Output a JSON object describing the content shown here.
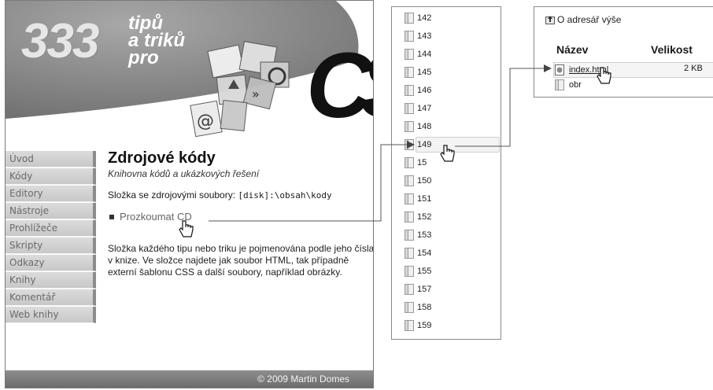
{
  "site": {
    "logo_number": "333",
    "logo_line1": "tipů",
    "logo_line2": "a triků",
    "logo_line3": "pro",
    "logo_brand": "CS",
    "menu": [
      "Úvod",
      "Kódy",
      "Editory",
      "Nástroje",
      "Prohlížeče",
      "Skripty",
      "Odkazy",
      "Knihy",
      "Komentář",
      "Web knihy"
    ],
    "title": "Zdrojové kódy",
    "subtitle": "Knihovna kódů a ukázkových řešení",
    "folder_label": "Složka se zdrojovými soubory:",
    "folder_path": "[disk]:\\obsah\\kody",
    "browse_link": "Prozkoumat CD",
    "description": "Složka každého tipu nebo triku je pojmenována podle jeho čísla v knize. Ve složce najdete jak soubor HTML, tak případně externí šablonu CSS a další soubory, například obrázky.",
    "footer": "© 2009 Martin Domes"
  },
  "folders": {
    "items": [
      "142",
      "143",
      "144",
      "145",
      "146",
      "147",
      "148",
      "149",
      "15",
      "150",
      "151",
      "152",
      "153",
      "154",
      "155",
      "157",
      "158",
      "159"
    ],
    "selected": "149"
  },
  "files": {
    "up_label": "O adresář výše",
    "col_name": "Název",
    "col_size": "Velikost",
    "rows": [
      {
        "name": "index.html",
        "size": "2 KB"
      },
      {
        "name": "obr",
        "size": ""
      }
    ]
  },
  "colors": {
    "menu_bg": "#d0d0d0",
    "footer_bg": "#7a7a7a",
    "banner_gray": "#8c8c8c"
  }
}
